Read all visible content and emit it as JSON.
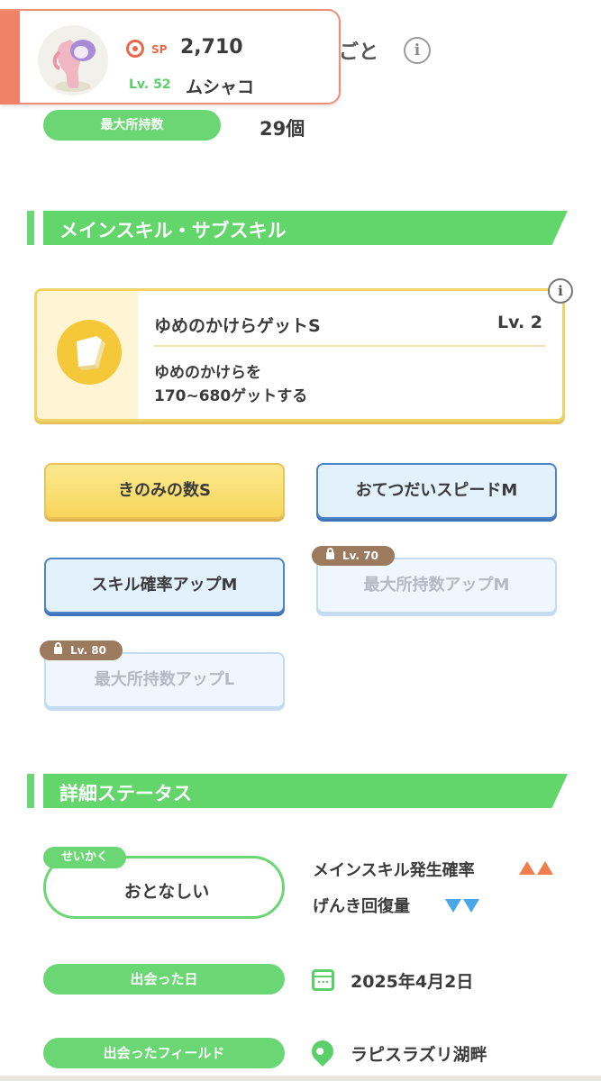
{
  "header": {
    "sp_label": "SP",
    "sp_value": "2,710",
    "level_label": "Lv. 52",
    "pokemon_name": "ムシャコ"
  },
  "behind_title": "ごと",
  "max_carry": {
    "label": "最大所持数",
    "value": "29個"
  },
  "sections": {
    "skills_title": "メインスキル・サブスキル",
    "details_title": "詳細ステータス"
  },
  "main_skill": {
    "name": "ゆめのかけらゲットS",
    "level": "Lv. 2",
    "description_line1": "ゆめのかけらを",
    "description_line2": "170~680ゲットする"
  },
  "sub_skills": [
    {
      "label": "きのみの数S",
      "style": "yellow",
      "locked": false
    },
    {
      "label": "おてつだいスピードM",
      "style": "blue",
      "locked": false
    },
    {
      "label": "スキル確率アップM",
      "style": "blue",
      "locked": false
    },
    {
      "label": "最大所持数アップM",
      "style": "locked",
      "locked": true,
      "unlock_level": "Lv. 70"
    },
    {
      "label": "最大所持数アップL",
      "style": "locked",
      "locked": true,
      "unlock_level": "Lv. 80"
    }
  ],
  "nature": {
    "tag": "せいかく",
    "value": "おとなしい",
    "up_effect": "メインスキル発生確率",
    "down_effect": "げんき回復量"
  },
  "met_date": {
    "label": "出会った日",
    "value": "2025年4月2日"
  },
  "met_field": {
    "label": "出会ったフィールド",
    "value": "ラピスラズリ湖畔"
  },
  "colors": {
    "accent_green": "#62d56b",
    "sp_orange": "#e8694a",
    "skill_gold": "#f5c83a",
    "up_arrow": "#ee7f4c",
    "down_arrow": "#4aa6e6"
  },
  "icons": [
    "sp-icon",
    "info-icon",
    "dream-shard-icon",
    "lock-icon",
    "calendar-icon",
    "location-pin-icon"
  ]
}
